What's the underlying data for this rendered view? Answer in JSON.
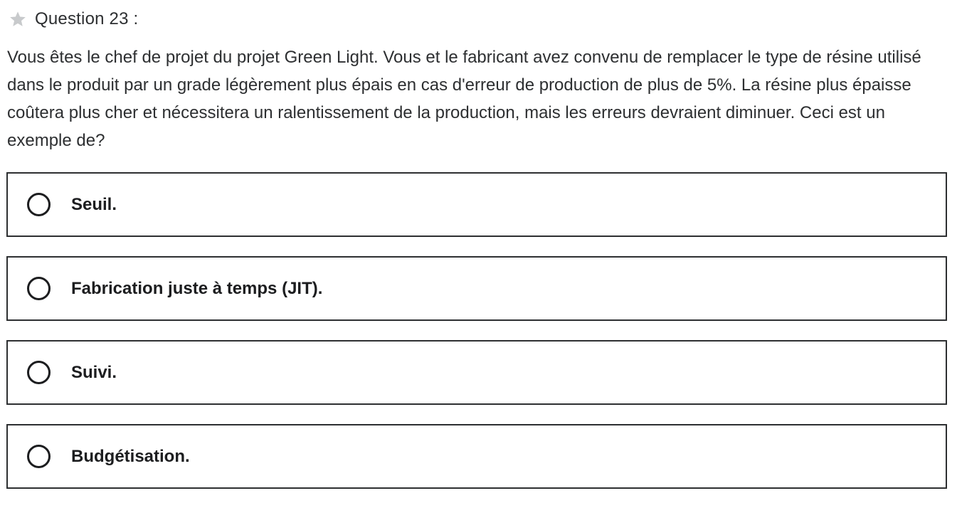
{
  "header": {
    "icon": "star-icon",
    "icon_color": "#c8cacc",
    "question_number": "Question 23 :"
  },
  "question": {
    "text": "Vous êtes le chef de projet du projet Green Light. Vous et le fabricant avez convenu de remplacer le type de résine utilisé dans le produit par un grade légèrement plus épais en cas d'erreur de production de plus de 5%. La résine plus épaisse coûtera plus cher et nécessitera un ralentissement de la production, mais les erreurs devraient diminuer. Ceci est un exemple de?"
  },
  "options": [
    {
      "label": "Seuil.",
      "selected": false
    },
    {
      "label": "Fabrication juste à temps (JIT).",
      "selected": false
    },
    {
      "label": "Suivi.",
      "selected": false
    },
    {
      "label": "Budgétisation.",
      "selected": false
    }
  ]
}
